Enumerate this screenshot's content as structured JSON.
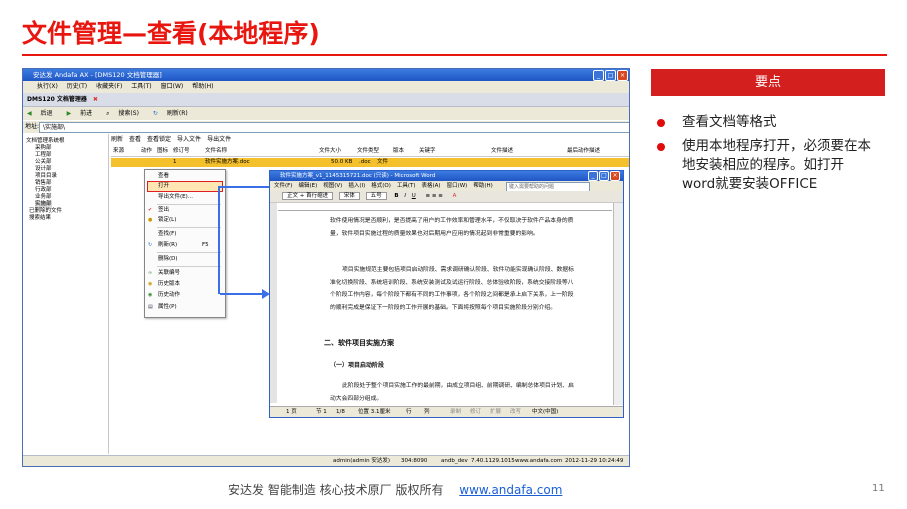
{
  "slide": {
    "title": "文件管理—查看(本地程序)",
    "key_points_header": "要点",
    "bullets": [
      "查看文档等格式",
      "使用本地程序打开，必须要在本地安装相应的程序。如打开word就要安装OFFICE"
    ],
    "footer_text": "安达发  智能制造 核心技术原厂   版权所有",
    "footer_link": "www.andafa.com",
    "page_number": "11"
  },
  "app": {
    "title": "安达发 Andafa AX - [DMS120 文档管理器]",
    "menu": [
      "执行(X)",
      "历史(T)",
      "收藏夹(F)",
      "工具(T)",
      "窗口(W)",
      "帮助(H)"
    ],
    "doc_tab": "DMS120 文档管理器",
    "toolbar": [
      "后退",
      "前进",
      "搜索(S)",
      "刷新(R)"
    ],
    "address_label": "地址:",
    "address_value": "\\实施部\\",
    "tree": [
      "文档管理系统根",
      "采购部",
      "工程部",
      "公关部",
      "设计部",
      "项目目录",
      "销售部",
      "行政部",
      "业务部",
      "实施部",
      "已删除的文件",
      "搜索结果"
    ],
    "list_toolbar": [
      "刷新",
      "查看",
      "查看锁定",
      "导入文件",
      "导出文件"
    ],
    "columns": [
      "来源",
      "动作",
      "图标",
      "修订号",
      "文件名称",
      "文件大小",
      "文件类型",
      "版本",
      "关键字",
      "文件描述",
      "最后动作描述"
    ],
    "row": {
      "rev": "1",
      "name": "软件实施方案.doc",
      "size": "50.0 KB",
      "ext": ".doc",
      "type": "文件"
    },
    "status": [
      "admin(admin 安达发)",
      "304:8090",
      "andb_dev",
      "7.40.1129.1015",
      "www.andafa.com",
      "2012-11-29 10:24:49"
    ]
  },
  "context_menu": {
    "items": [
      {
        "label": "查看",
        "shortcut": ""
      },
      {
        "label": "打开",
        "shortcut": ""
      },
      {
        "label": "导出文件(E)...",
        "shortcut": ""
      },
      {
        "label": "签出",
        "shortcut": ""
      },
      {
        "label": "锁定(L)",
        "shortcut": ""
      },
      {
        "label": "查找(F)",
        "shortcut": ""
      },
      {
        "label": "刷新(R)",
        "shortcut": "F5"
      },
      {
        "label": "删除(D)",
        "shortcut": ""
      },
      {
        "label": "关联编号",
        "shortcut": ""
      },
      {
        "label": "历史版本",
        "shortcut": ""
      },
      {
        "label": "历史动作",
        "shortcut": ""
      },
      {
        "label": "属性(P)",
        "shortcut": ""
      }
    ]
  },
  "word": {
    "title": "软件实施方案_v1_1145315721.doc (只读) - Microsoft Word",
    "menu": [
      "文件(F)",
      "编辑(E)",
      "视图(V)",
      "插入(I)",
      "格式(O)",
      "工具(T)",
      "表格(A)",
      "窗口(W)",
      "帮助(H)"
    ],
    "help_placeholder": "键入需要帮助的问题",
    "style": "正文 + 首行缩进",
    "font": "宋体",
    "size": "五号",
    "para1": "软件使用情况是否顺利，是否提高了用户的工作效率和管理水平，不仅取决于软件产品本身的质量，软件项目实施过程的质量效果也对后期用户应用的情况起到非常重要的影响。",
    "para2": "项目实施规范主要包括项目启动阶段、需求调研确认阶段、软件功能实现确认阶段、数据标准化切换阶段、系统培训阶段、系统安装测试及试运行阶段、总体验收阶段，系统交接阶段等八个阶段工作内容，每个阶段下都有不同的工作事项，各个阶段之间都是承上启下关系，上一阶段的顺利完成是保证下一阶段的工作开展的基础。下面将按照每个项目实施阶段分别介绍。",
    "heading2": "二、软件项目实施方案",
    "heading3": "（一）项目启动阶段",
    "para3": "此阶段处于整个项目实施工作的最前期，由成立项目组、前期调研、编制总体项目计划、启动大会四部分组成。",
    "status": [
      "1 页",
      "节 1",
      "1/8",
      "位置 3.1厘米",
      "行",
      "列",
      "录制",
      "修订",
      "扩展",
      "改写",
      "中文(中国)"
    ]
  }
}
